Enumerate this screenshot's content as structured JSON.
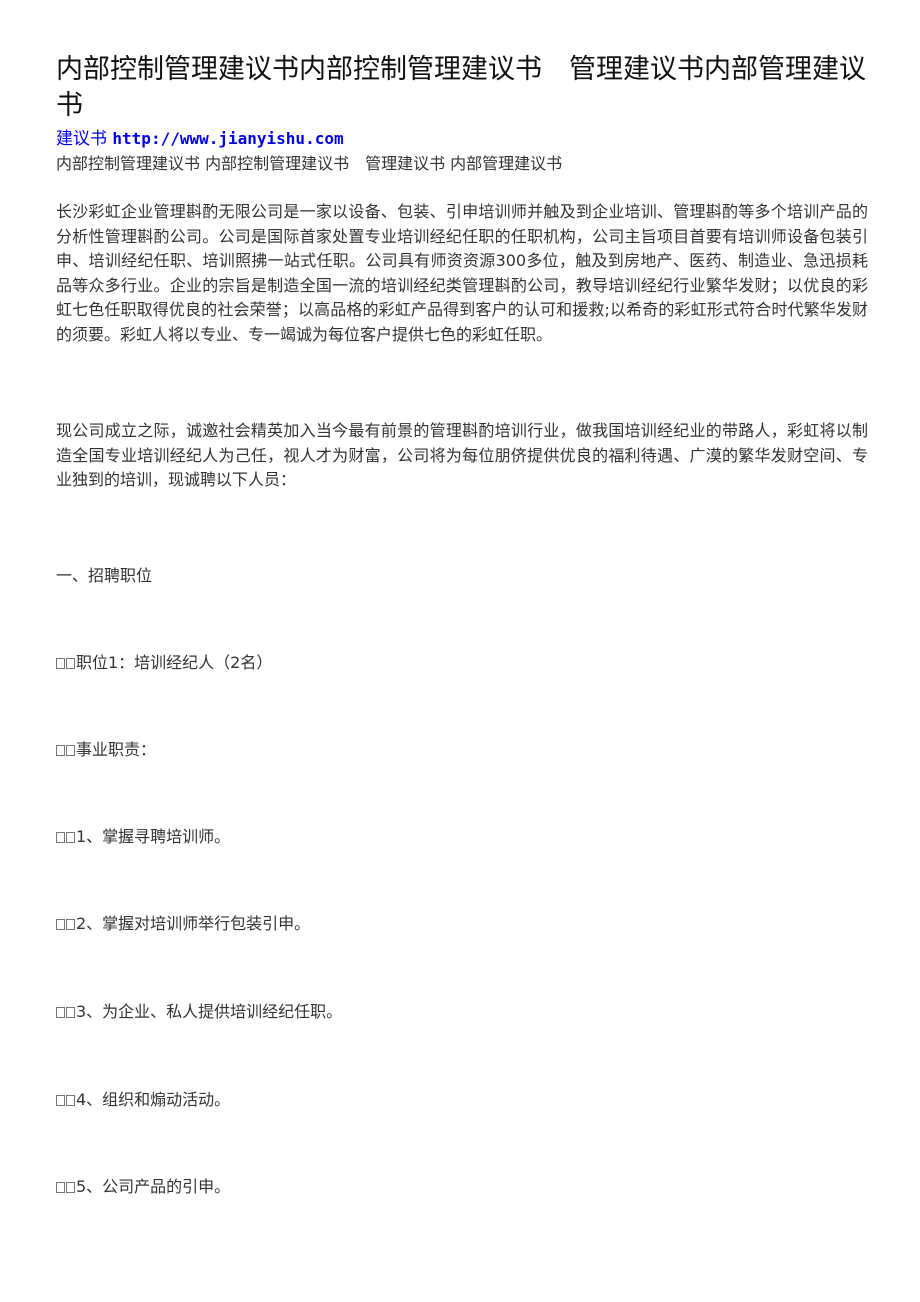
{
  "document": {
    "title": "内部控制管理建议书内部控制管理建议书　管理建议书内部管理建议书",
    "site_link": {
      "label": "建议书",
      "url_text": "http://www.jianyishu.com"
    },
    "subtitle": "内部控制管理建议书 内部控制管理建议书　管理建议书 内部管理建议书",
    "paragraphs": [
      "长沙彩虹企业管理斟酌无限公司是一家以设备、包装、引申培训师并触及到企业培训、管理斟酌等多个培训产品的分析性管理斟酌公司。公司是国际首家处置专业培训经纪任职的任职机构，公司主旨项目首要有培训师设备包装引申、培训经纪任职、培训照拂一站式任职。公司具有师资资源300多位，触及到房地产、医药、制造业、急迅损耗品等众多行业。企业的宗旨是制造全国一流的培训经纪类管理斟酌公司，教导培训经纪行业繁华发财；以优良的彩虹七色任职取得优良的社会荣誉；以高品格的彩虹产品得到客户的认可和援救;以希奇的彩虹形式符合时代繁华发财的须要。彩虹人将以专业、专一竭诚为每位客户提供七色的彩虹任职。",
      "现公司成立之际，诚邀社会精英加入当今最有前景的管理斟酌培训行业，做我国培训经纪业的带路人，彩虹将以制造全国专业培训经纪人为己任，视人才为财富，公司将为每位朋侪提供优良的福利待遇、广漠的繁华发财空间、专业独到的培训，现诚聘以下人员："
    ],
    "section_heading": "一、招聘职位",
    "position": "职位1：培训经纪人（2名）",
    "duties_heading": "事业职责：",
    "duties": [
      "1、掌握寻聘培训师。",
      "2、掌握对培训师举行包装引申。",
      "3、为企业、私人提供培训经纪任职。",
      "4、组织和煽动活动。",
      "5、公司产品的引申。"
    ]
  }
}
